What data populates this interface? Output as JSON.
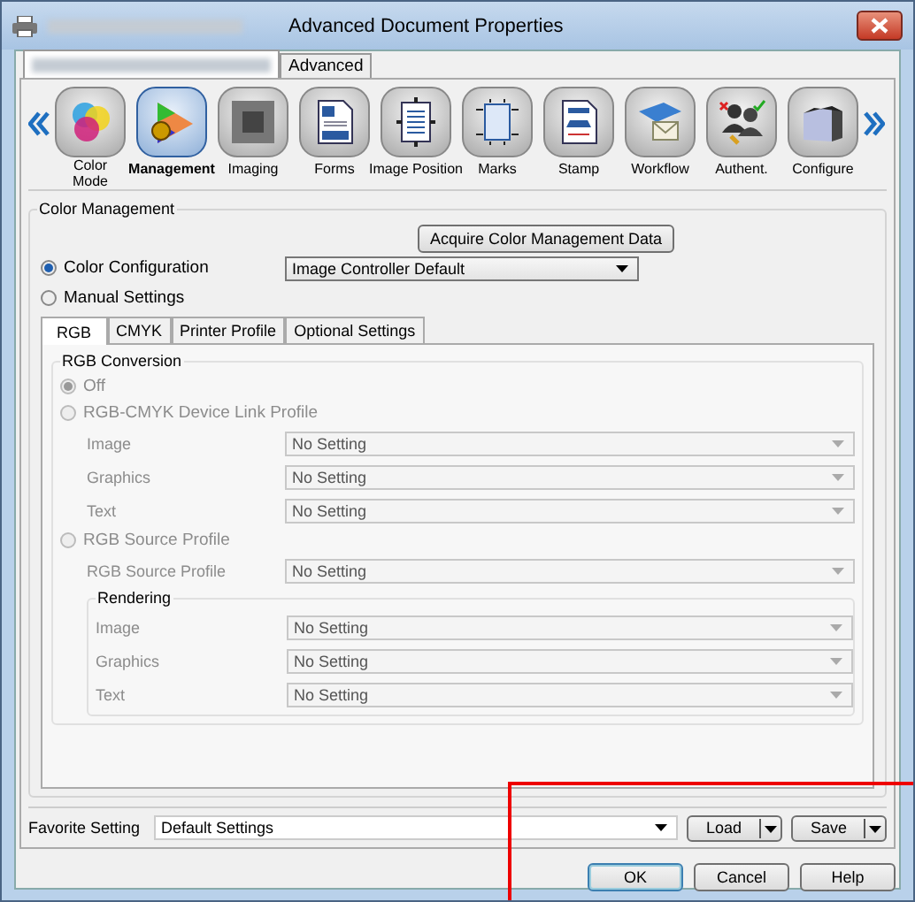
{
  "window": {
    "title": "Advanced Document Properties"
  },
  "tabs": [
    {
      "redacted": true,
      "selected": true
    },
    {
      "label": "Advanced",
      "selected": false
    }
  ],
  "toolbar": {
    "items": [
      {
        "label": "Color Mode",
        "kind": "colors",
        "selected": false
      },
      {
        "label": "Management",
        "kind": "gamut",
        "selected": true
      },
      {
        "label": "Imaging",
        "kind": "halftone",
        "selected": false
      },
      {
        "label": "Forms",
        "kind": "form",
        "selected": false
      },
      {
        "label": "Image Position",
        "kind": "position",
        "selected": false
      },
      {
        "label": "Marks",
        "kind": "marks",
        "selected": false
      },
      {
        "label": "Stamp",
        "kind": "stamp",
        "selected": false
      },
      {
        "label": "Workflow",
        "kind": "workflow",
        "selected": false
      },
      {
        "label": "Authent.",
        "kind": "people",
        "selected": false
      },
      {
        "label": "Configure",
        "kind": "device",
        "selected": false
      }
    ]
  },
  "color_management": {
    "title": "Color Management",
    "acquire_button": "Acquire Color Management Data",
    "options": [
      {
        "label": "Color Configuration",
        "selected": true
      },
      {
        "label": "Manual Settings",
        "selected": false
      }
    ],
    "configuration_select": "Image Controller Default",
    "subtabs": [
      {
        "label": "RGB",
        "selected": true
      },
      {
        "label": "CMYK",
        "selected": false
      },
      {
        "label": "Printer Profile",
        "selected": false
      },
      {
        "label": "Optional Settings",
        "selected": false
      }
    ],
    "rgb_conversion": {
      "title": "RGB Conversion",
      "disabled": true,
      "options": [
        {
          "label": "Off",
          "selected": true
        },
        {
          "label": "RGB-CMYK Device Link Profile",
          "selected": false,
          "fields": [
            {
              "label": "Image",
              "value": "No Setting"
            },
            {
              "label": "Graphics",
              "value": "No Setting"
            },
            {
              "label": "Text",
              "value": "No Setting"
            }
          ]
        },
        {
          "label": "RGB Source Profile",
          "selected": false,
          "fields": [
            {
              "label": "RGB Source Profile",
              "value": "No Setting"
            }
          ],
          "rendering": {
            "title": "Rendering",
            "fields": [
              {
                "label": "Image",
                "value": "No Setting"
              },
              {
                "label": "Graphics",
                "value": "No Setting"
              },
              {
                "label": "Text",
                "value": "No Setting"
              }
            ]
          }
        }
      ]
    }
  },
  "favorite": {
    "label": "Favorite Setting",
    "value": "Default Settings",
    "buttons": [
      "Load",
      "Save"
    ]
  },
  "buttons": [
    {
      "label": "OK",
      "default": true
    },
    {
      "label": "Cancel",
      "default": false
    },
    {
      "label": "Help",
      "default": false
    }
  ]
}
